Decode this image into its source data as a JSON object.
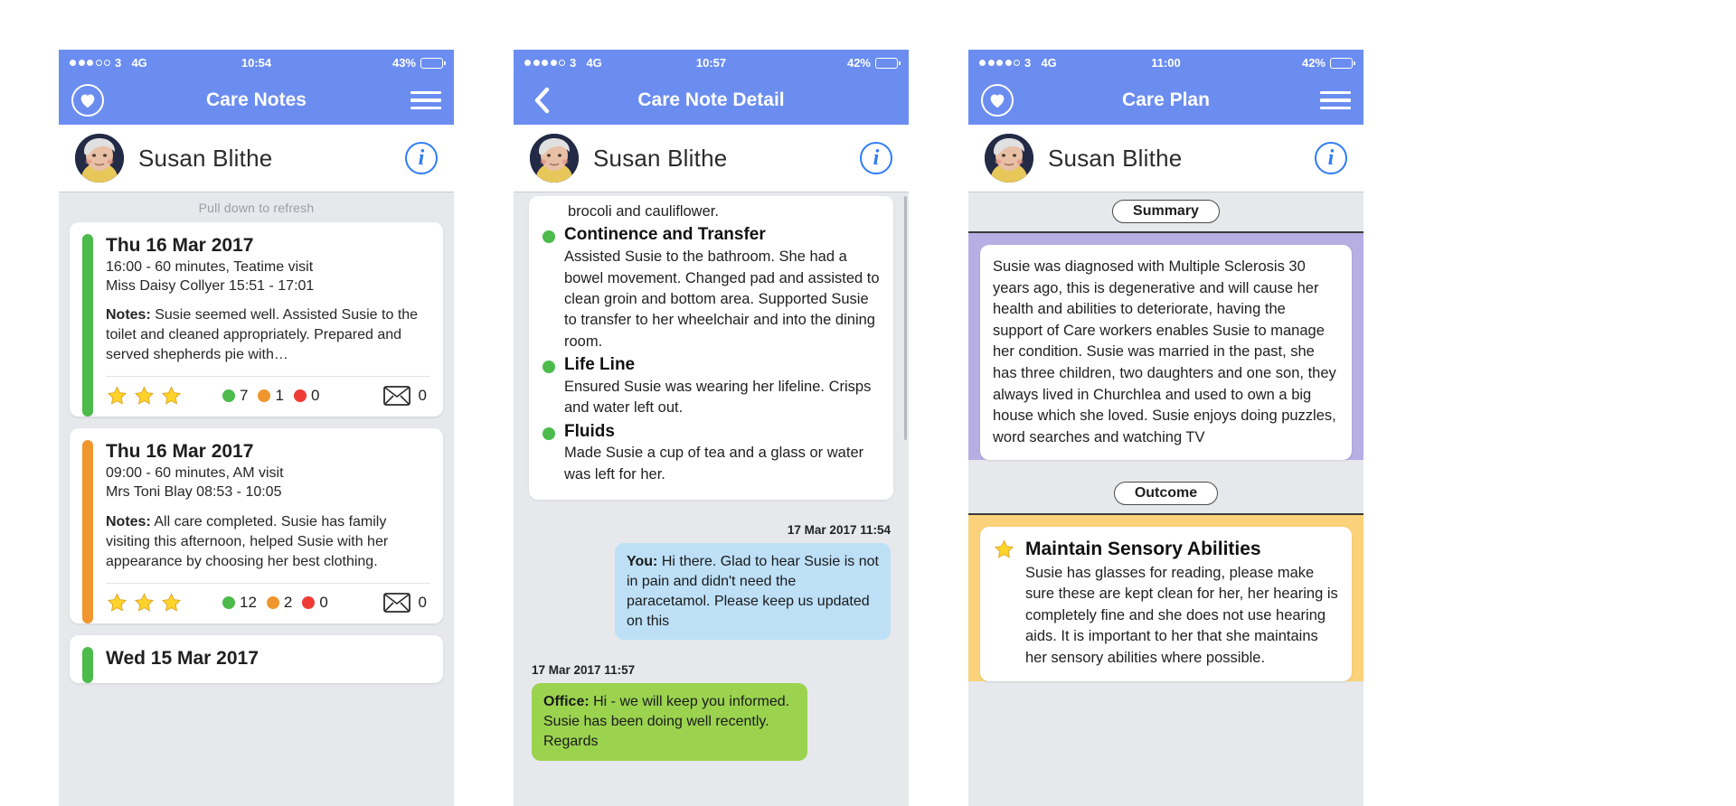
{
  "colors": {
    "nav_blue": "#6b8df0",
    "accent_blue": "#2f7cf6",
    "green": "#4cbb4c",
    "orange": "#f0962e",
    "red": "#ef3b35",
    "star_gold": "#ffd42a",
    "summary_purple": "#b7aee4",
    "outcome_yellow": "#fbd279",
    "bubble_you": "#bde0f7",
    "bubble_office": "#9bd34f",
    "screen_bg": "#e6e8ec"
  },
  "screens": [
    {
      "id": "care-notes",
      "status": {
        "signal_filled": 3,
        "signal_total": 5,
        "carrier": "3",
        "network": "4G",
        "time": "10:54",
        "battery_pct": "43%",
        "battery_level": 43
      },
      "nav": {
        "left_icon": "heart-icon",
        "title": "Care Notes",
        "right_icon": "hamburger-menu-icon"
      },
      "patient": {
        "name": "Susan Blithe",
        "info_icon": "info-icon",
        "avatar": "patient-avatar"
      },
      "pull_refresh": "Pull down to refresh",
      "notes": [
        {
          "bar_color": "#4cbb4c",
          "date": "Thu 16 Mar 2017",
          "schedule": "16:00 - 60 minutes, Teatime visit",
          "carer": "Miss Daisy Collyer 15:51 - 17:01",
          "notes_label": "Notes:",
          "notes_text": "Susie seemed well. Assisted Susie to the toilet and cleaned appropriately. Prepared and served shepherds pie with…",
          "stars": 3,
          "green_count": "7",
          "orange_count": "1",
          "red_count": "0",
          "message_count": "0"
        },
        {
          "bar_color": "#f0962e",
          "date": "Thu 16 Mar 2017",
          "schedule": "09:00 - 60 minutes, AM visit",
          "carer": "Mrs Toni Blay 08:53 - 10:05",
          "notes_label": "Notes:",
          "notes_text": "All care completed. Susie has family visiting this afternoon, helped Susie with her appearance by choosing her best clothing.",
          "stars": 3,
          "green_count": "12",
          "orange_count": "2",
          "red_count": "0",
          "message_count": "0"
        },
        {
          "bar_color": "#4cbb4c",
          "date": "Wed 15 Mar 2017",
          "schedule": "",
          "carer": "",
          "notes_label": "",
          "notes_text": "",
          "stars": 0,
          "green_count": "",
          "orange_count": "",
          "red_count": "",
          "message_count": ""
        }
      ]
    },
    {
      "id": "care-note-detail",
      "status": {
        "signal_filled": 4,
        "signal_total": 5,
        "carrier": "3",
        "network": "4G",
        "time": "10:57",
        "battery_pct": "42%",
        "battery_level": 42
      },
      "nav": {
        "left_icon": "back-chevron-icon",
        "title": "Care Note Detail",
        "right_icon": "none"
      },
      "patient": {
        "name": "Susan Blithe",
        "info_icon": "info-icon",
        "avatar": "patient-avatar"
      },
      "continued_text": "brocoli and cauliflower.",
      "items": [
        {
          "title": "Continence and Transfer",
          "body": "Assisted Susie to the bathroom. She had a bowel movement. Changed pad and assisted to clean groin and bottom area. Supported Susie to transfer to her wheelchair and into the dining room."
        },
        {
          "title": "Life Line",
          "body": "Ensured Susie was wearing her lifeline. Crisps and water left out."
        },
        {
          "title": "Fluids",
          "body": "Made Susie a cup of tea and a glass or water was left for her."
        }
      ],
      "messages": [
        {
          "timestamp": "17 Mar 2017 11:54",
          "align": "right",
          "sender": "You:",
          "text": "Hi there. Glad to hear Susie is not in pain and didn't need the paracetamol. Please keep us updated on this",
          "style": "them"
        },
        {
          "timestamp": "17 Mar 2017 11:57",
          "align": "left",
          "sender": "Office:",
          "text": "Hi - we will keep you informed. Susie has been doing well recently. Regards",
          "style": "office"
        }
      ]
    },
    {
      "id": "care-plan",
      "status": {
        "signal_filled": 4,
        "signal_total": 5,
        "carrier": "3",
        "network": "4G",
        "time": "11:00",
        "battery_pct": "42%",
        "battery_level": 42
      },
      "nav": {
        "left_icon": "heart-icon",
        "title": "Care Plan",
        "right_icon": "hamburger-menu-icon"
      },
      "patient": {
        "name": "Susan Blithe",
        "info_icon": "info-icon",
        "avatar": "patient-avatar"
      },
      "sections": [
        {
          "tab_label": "Summary",
          "band_color": "#b7aee4",
          "text": "Susie was diagnosed with Multiple Sclerosis 30 years ago, this is degenerative and will cause her health and abilities to deteriorate, having the support of Care workers enables Susie to manage her condition. Susie was married in the past, she has three children, two daughters and one son, they always lived in Churchlea and used to own a big house which she loved. Susie enjoys doing puzzles, word searches and watching TV"
        },
        {
          "tab_label": "Outcome",
          "band_color": "#fbd279",
          "star_icon": "star-icon",
          "title": "Maintain Sensory Abilities",
          "text": "Susie has glasses for reading, please make sure these are kept clean for her, her hearing is completely fine and she does not use hearing aids. It is important to her that she maintains her sensory abilities where possible."
        }
      ]
    }
  ]
}
